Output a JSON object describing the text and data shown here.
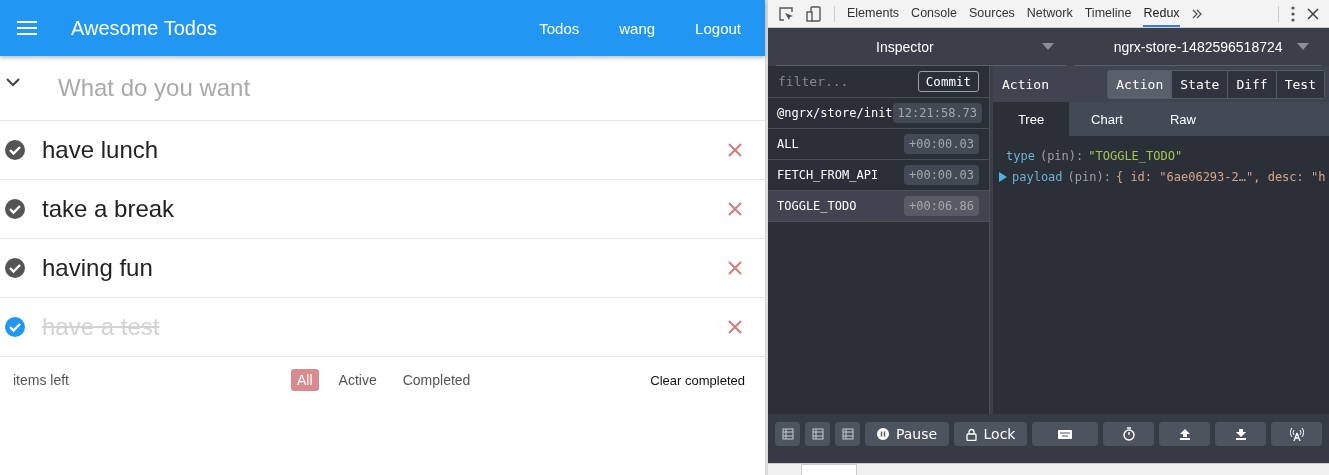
{
  "app": {
    "title": "Awesome Todos",
    "nav": [
      "Todos",
      "wang",
      "Logout"
    ]
  },
  "new_todo": {
    "placeholder": "What do you want"
  },
  "todos": [
    {
      "text": "have lunch",
      "completed": false
    },
    {
      "text": "take a break",
      "completed": false
    },
    {
      "text": "having fun",
      "completed": false
    },
    {
      "text": "have a test",
      "completed": true
    }
  ],
  "footer": {
    "count_label": "items left",
    "filters": [
      {
        "label": "All",
        "selected": true
      },
      {
        "label": "Active",
        "selected": false
      },
      {
        "label": "Completed",
        "selected": false
      }
    ],
    "clear": "Clear completed"
  },
  "devtools": {
    "tabs": [
      {
        "label": "Elements",
        "selected": false
      },
      {
        "label": "Console",
        "selected": false
      },
      {
        "label": "Sources",
        "selected": false
      },
      {
        "label": "Network",
        "selected": false
      },
      {
        "label": "Timeline",
        "selected": false
      },
      {
        "label": "Redux",
        "selected": true
      }
    ],
    "monitor": "Inspector",
    "store": "ngrx-store-1482596518724",
    "filter": {
      "placeholder": "filter..."
    },
    "commit": "Commit",
    "actions": [
      {
        "name": "@ngrx/store/init",
        "time": "12:21:58.73",
        "selected": false
      },
      {
        "name": "ALL",
        "time": "+00:00.03",
        "selected": false
      },
      {
        "name": "FETCH_FROM_API",
        "time": "+00:00.03",
        "selected": false
      },
      {
        "name": "TOGGLE_TODO",
        "time": "+00:06.86",
        "selected": true
      }
    ],
    "detail_title": "Action",
    "modes": [
      {
        "label": "Action",
        "selected": true
      },
      {
        "label": "State",
        "selected": false
      },
      {
        "label": "Diff",
        "selected": false
      },
      {
        "label": "Test",
        "selected": false
      }
    ],
    "subtabs": [
      {
        "label": "Tree",
        "selected": true
      },
      {
        "label": "Chart",
        "selected": false
      },
      {
        "label": "Raw",
        "selected": false
      }
    ],
    "tree": [
      {
        "key": "type",
        "pin": "(pin):",
        "value": "\"TOGGLE_TODO\"",
        "expandable": false
      },
      {
        "key": "payload",
        "pin": "(pin):",
        "value": "{ id: \"6ae06293-2…\", desc: \"h",
        "expandable": true
      }
    ],
    "toolbar": [
      {
        "kind": "layout"
      },
      {
        "kind": "layout"
      },
      {
        "kind": "layout"
      },
      {
        "kind": "pause",
        "label": "Pause"
      },
      {
        "kind": "lock",
        "label": "Lock"
      },
      {
        "kind": "keyboard"
      },
      {
        "kind": "timer"
      },
      {
        "kind": "upload"
      },
      {
        "kind": "download"
      },
      {
        "kind": "remote"
      }
    ]
  }
}
